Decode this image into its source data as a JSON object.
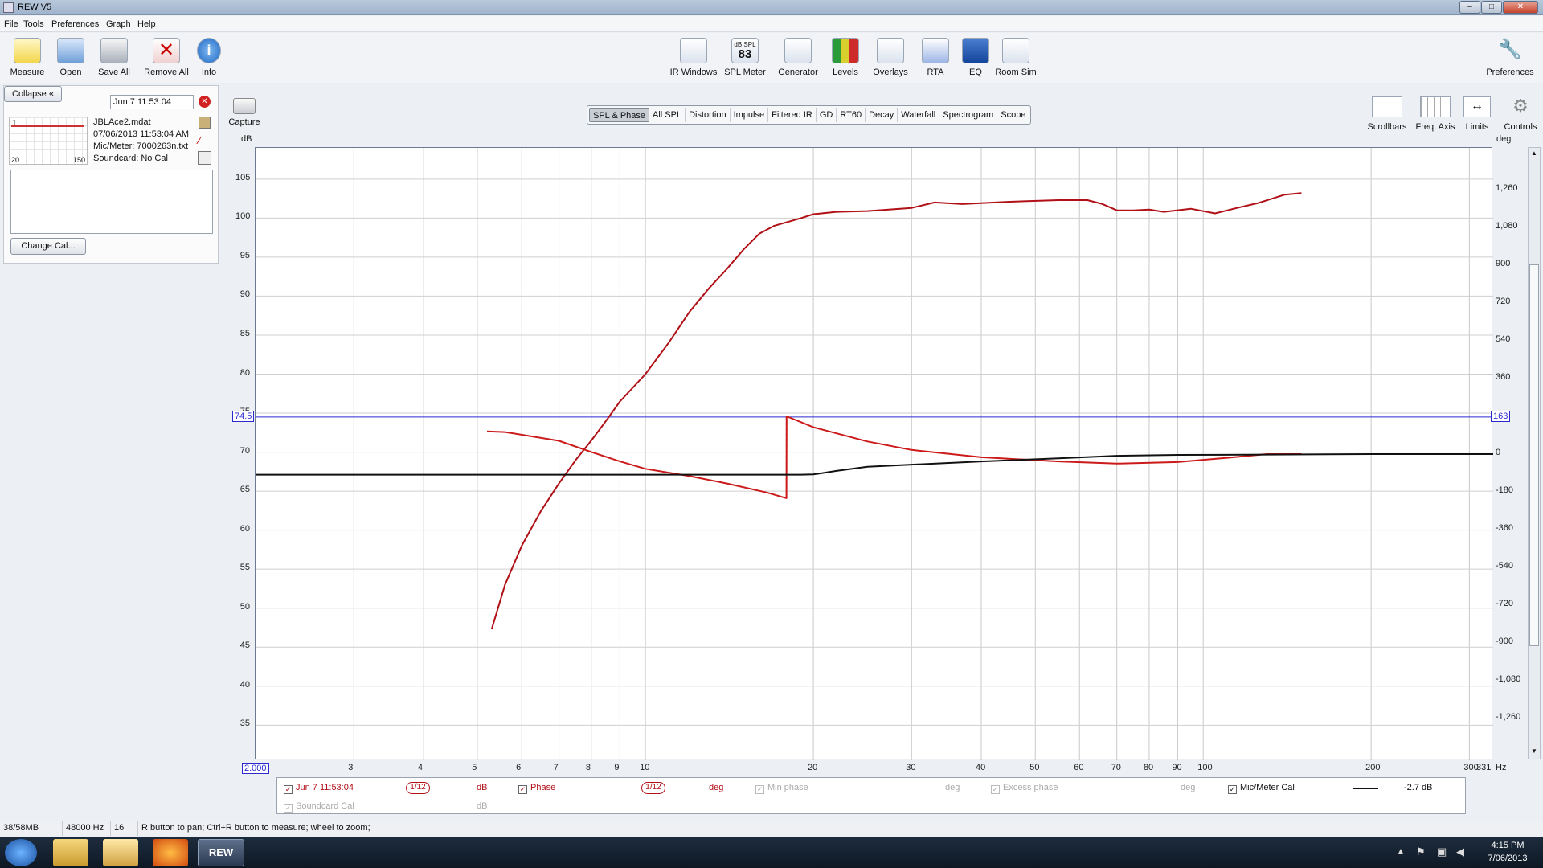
{
  "window": {
    "title": "REW V5"
  },
  "menu": [
    "File",
    "Tools",
    "Preferences",
    "Graph",
    "Help"
  ],
  "toolbar_left": [
    {
      "label": "Measure",
      "icon": "measure-icon"
    },
    {
      "label": "Open",
      "icon": "open-folder-icon"
    },
    {
      "label": "Save All",
      "icon": "save-icon"
    },
    {
      "label": "Remove All",
      "icon": "remove-icon"
    },
    {
      "label": "Info",
      "icon": "info-icon"
    }
  ],
  "toolbar_center": [
    {
      "label": "IR Windows",
      "icon": "ir-windows-icon"
    },
    {
      "label": "SPL Meter",
      "icon": "spl-meter-icon",
      "value": "83",
      "caption": "dB SPL"
    },
    {
      "label": "Generator",
      "icon": "generator-icon"
    },
    {
      "label": "Levels",
      "icon": "levels-icon"
    },
    {
      "label": "Overlays",
      "icon": "overlays-icon"
    },
    {
      "label": "RTA",
      "icon": "rta-icon"
    },
    {
      "label": "EQ",
      "icon": "eq-icon"
    },
    {
      "label": "Room Sim",
      "icon": "room-sim-icon"
    }
  ],
  "preferences_label": "Preferences",
  "left_panel": {
    "collapse_label": "Collapse",
    "measurement_name": "Jun 7 11:53:04",
    "file": "JBLAce2.mdat",
    "datetime": "07/06/2013 11:53:04 AM",
    "mic": "Mic/Meter: 7000263n.txt",
    "soundcard": "Soundcard: No Cal",
    "thumb_index": "1",
    "thumb_axis_left": "20",
    "thumb_axis_right": "150",
    "change_cal_label": "Change Cal..."
  },
  "capture_label": "Capture",
  "graph_tabs": [
    "SPL & Phase",
    "All SPL",
    "Distortion",
    "Impulse",
    "Filtered IR",
    "GD",
    "RT60",
    "Decay",
    "Waterfall",
    "Spectrogram",
    "Scope"
  ],
  "active_tab": "SPL & Phase",
  "right_tools": [
    {
      "label": "Scrollbars",
      "icon": "scrollbars-icon"
    },
    {
      "label": "Freq. Axis",
      "icon": "freq-axis-icon"
    },
    {
      "label": "Limits",
      "icon": "limits-icon"
    },
    {
      "label": "Controls",
      "icon": "controls-gear-icon"
    }
  ],
  "chart_data": {
    "type": "line",
    "ylabel": "dB",
    "y2label": "deg",
    "xunit": "Hz",
    "xscale": "log",
    "xlim": [
      2,
      331
    ],
    "ylim": [
      30.5,
      109
    ],
    "y2lim": [
      -1458,
      1458
    ],
    "xticks": [
      "2.000",
      "3",
      "4",
      "5",
      "6",
      "7",
      "8",
      "9",
      "10",
      "20",
      "30",
      "40",
      "50",
      "60",
      "70",
      "80",
      "90",
      "100",
      "200",
      "300",
      "331"
    ],
    "xtick_values": [
      2,
      3,
      4,
      5,
      6,
      7,
      8,
      9,
      10,
      20,
      30,
      40,
      50,
      60,
      70,
      80,
      90,
      100,
      200,
      300,
      331
    ],
    "yticks": [
      105,
      100,
      95,
      90,
      85,
      80,
      75,
      70,
      65,
      60,
      55,
      50,
      45,
      40,
      35
    ],
    "y2ticks": [
      "1,260",
      "1,080",
      "900",
      "720",
      "540",
      "360",
      "180",
      "0",
      "-180",
      "-360",
      "-540",
      "-720",
      "-900",
      "-1,080",
      "-1,260"
    ],
    "y2tick_values": [
      1260,
      1080,
      900,
      720,
      540,
      360,
      180,
      0,
      -180,
      -360,
      -540,
      -720,
      -900,
      -1080,
      -1260
    ],
    "cursor_line": {
      "db": 74.5,
      "db_label": "74.5",
      "deg_label": "163"
    },
    "series": [
      {
        "name": "Jun 7 11:53:04",
        "axis": "left",
        "color": "#b01016",
        "points": [
          [
            5.3,
            47.3
          ],
          [
            5.6,
            53
          ],
          [
            6,
            58
          ],
          [
            6.5,
            62.5
          ],
          [
            7,
            66
          ],
          [
            7.5,
            69
          ],
          [
            8,
            71.5
          ],
          [
            8.5,
            74
          ],
          [
            9,
            76.5
          ],
          [
            10,
            80
          ],
          [
            11,
            84
          ],
          [
            12,
            88
          ],
          [
            13,
            91
          ],
          [
            14,
            93.5
          ],
          [
            15,
            96
          ],
          [
            16,
            98
          ],
          [
            17,
            99
          ],
          [
            19,
            100
          ],
          [
            20,
            100.5
          ],
          [
            22,
            100.8
          ],
          [
            25,
            100.9
          ],
          [
            30,
            101.3
          ],
          [
            33,
            102
          ],
          [
            37,
            101.8
          ],
          [
            45,
            102.1
          ],
          [
            55,
            102.3
          ],
          [
            62,
            102.3
          ],
          [
            66,
            101.8
          ],
          [
            70,
            101
          ],
          [
            75,
            101
          ],
          [
            80,
            101.1
          ],
          [
            85,
            100.8
          ],
          [
            95,
            101.2
          ],
          [
            105,
            100.6
          ],
          [
            115,
            101.3
          ],
          [
            125,
            101.9
          ],
          [
            140,
            103
          ],
          [
            150,
            103.2
          ]
        ]
      },
      {
        "name": "Phase",
        "axis": "right",
        "color": "#cc1a1a",
        "points": [
          [
            5.2,
            108
          ],
          [
            5.6,
            105
          ],
          [
            7,
            63
          ],
          [
            8,
            10
          ],
          [
            9,
            -35
          ],
          [
            10,
            -70
          ],
          [
            12,
            -105
          ],
          [
            14,
            -140
          ],
          [
            16.5,
            -183
          ],
          [
            17.9,
            -210
          ],
          [
            17.91,
            180
          ],
          [
            20,
            128
          ],
          [
            25,
            60
          ],
          [
            30,
            20
          ],
          [
            40,
            -15
          ],
          [
            55,
            -35
          ],
          [
            70,
            -45
          ],
          [
            90,
            -38
          ],
          [
            110,
            -18
          ],
          [
            130,
            0
          ],
          [
            150,
            0
          ]
        ]
      },
      {
        "name": "Mic/Meter Cal",
        "axis": "right",
        "color": "#111111",
        "points": [
          [
            2,
            -98
          ],
          [
            19,
            -98
          ],
          [
            20,
            -97
          ],
          [
            22,
            -80
          ],
          [
            25,
            -60
          ],
          [
            30,
            -50
          ],
          [
            40,
            -35
          ],
          [
            55,
            -20
          ],
          [
            70,
            -8
          ],
          [
            90,
            -4
          ],
          [
            120,
            -3
          ],
          [
            200,
            0
          ],
          [
            331,
            0
          ]
        ]
      }
    ]
  },
  "legend": {
    "row1": [
      {
        "label": "Jun 7 11:53:04",
        "checked": true,
        "smoothing": "1/12",
        "unit": "dB"
      },
      {
        "label": "Phase",
        "checked": true,
        "smoothing": "1/12",
        "unit": "deg"
      },
      {
        "label": "Min phase",
        "checked": true,
        "unit": "deg"
      },
      {
        "label": "Excess phase",
        "checked": true,
        "unit": "deg"
      },
      {
        "label": "Mic/Meter Cal",
        "checked": true,
        "value": "-2.7 dB"
      }
    ],
    "row2": [
      {
        "label": "Soundcard Cal",
        "checked": true,
        "unit": "dB"
      }
    ]
  },
  "status": {
    "memory": "38/58MB",
    "rate": "48000 Hz",
    "bits": "16 Bit",
    "hint": "R button to pan; Ctrl+R button to measure; wheel to zoom;"
  },
  "taskbar": {
    "clock_time": "4:15 PM",
    "clock_date": "7/06/2013",
    "app_label": "REW"
  }
}
